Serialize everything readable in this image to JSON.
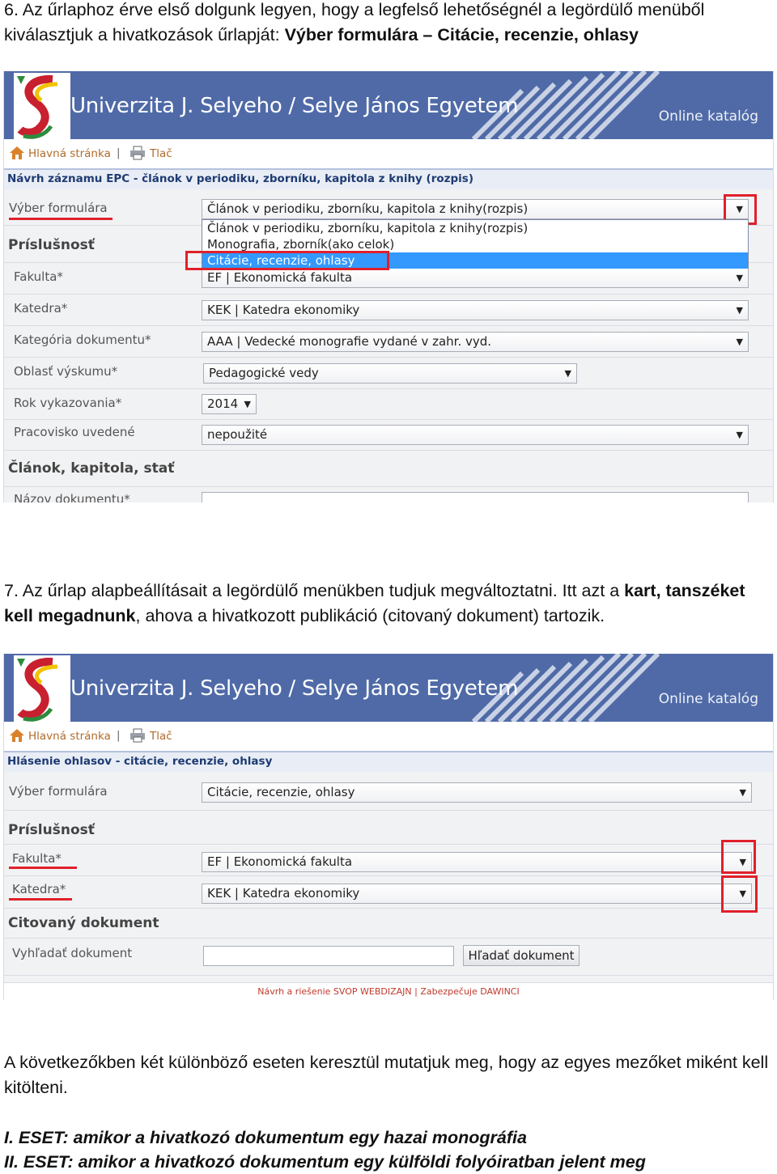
{
  "step6": {
    "number": "6.",
    "text_before": "Az űrlaphoz érve első dolgunk legyen, hogy a legfelső lehetőségnél a legördülő menüből kiválasztjuk a hivatkozások űrlapját:",
    "text_bold": "Výber formulára – Citácie, recenzie, ohlasy"
  },
  "step7": {
    "number": "7.",
    "text_before": "Az űrlap alapbeállításait a legördülő menükben tudjuk megváltoztatni. Itt azt a",
    "text_bold": "kart, tanszéket kell megadnunk",
    "text_after": ", ahova a hivatkozott publikáció (citovaný dokument) tartozik."
  },
  "conclusion": {
    "text": "A következőkben két különböző eseten keresztül mutatjuk meg, hogy az egyes mezőket miként kell kitölteni.",
    "case1": "I. ESET: amikor a hivatkozó dokumentum egy hazai monográfia",
    "case2": "II. ESET: amikor a hivatkozó dokumentum egy külföldi folyóiratban jelent meg"
  },
  "banner": {
    "title": "Univerzita J. Selyeho / Selye János Egyetem",
    "catalog": "Online katalóg"
  },
  "toolbar": {
    "home": "Hlavná stránka",
    "separator": "|",
    "print": "Tlač"
  },
  "screenshot1": {
    "header": "Návrh záznamu EPC - článok v periodiku, zborníku, kapitola z knihy (rozpis)",
    "form_select_label": "Výber formulára",
    "form_select_value": "Článok v periodiku, zborníku, kapitola z knihy(rozpis)",
    "dropdown_options": [
      "Článok v periodiku, zborníku, kapitola z knihy(rozpis)",
      "Monografia, zborník(ako celok)",
      "Citácie, recenzie, ohlasy"
    ],
    "section_affiliation": "Príslušnosť",
    "faculty_label": "Fakulta*",
    "faculty_value": "EF | Ekonomická fakulta",
    "department_label": "Katedra*",
    "department_value": "KEK | Katedra ekonomiky",
    "doc_category_label": "Kategória dokumentu*",
    "doc_category_value": "AAA | Vedecké monografie vydané v zahr. vyd.",
    "research_label": "Oblasť výskumu*",
    "research_value": "Pedagogické vedy",
    "year_label": "Rok vykazovania*",
    "year_value": "2014",
    "workplace_label": "Pracovisko uvedené",
    "workplace_value": "nepoužité",
    "section_article": "Článok, kapitola, stať",
    "doc_name_label": "Názov dokumentu*"
  },
  "screenshot2": {
    "header": "Hlásenie ohlasov - citácie, recenzie, ohlasy",
    "form_select_label": "Výber formulára",
    "form_select_value": "Citácie, recenzie, ohlasy",
    "section_affiliation": "Príslušnosť",
    "faculty_label": "Fakulta*",
    "faculty_value": "EF | Ekonomická fakulta",
    "department_label": "Katedra*",
    "department_value": "KEK | Katedra ekonomiky",
    "section_cited": "Citovaný dokument",
    "search_label": "Vyhľadať dokument",
    "search_button": "Hľadať dokument",
    "footer": "Návrh a riešenie SVOP WEBDIZAJN | Zabezpečuje DAWINCI"
  },
  "colors": {
    "banner": "#4f6aa7",
    "highlight": "#3399ff",
    "annotation": "#e0202a"
  }
}
